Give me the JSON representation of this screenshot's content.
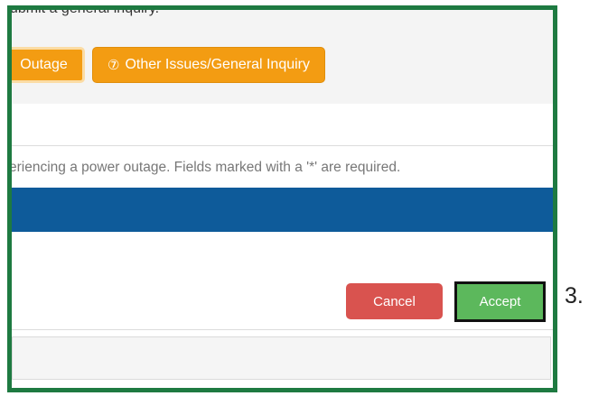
{
  "header": {
    "cut_text": "ubmit a general inquiry."
  },
  "buttons": {
    "outage_label": "Outage",
    "other_label": "Other Issues/General Inquiry",
    "other_icon": "question-circle-icon",
    "cancel_label": "Cancel",
    "accept_label": "Accept"
  },
  "form": {
    "info_text": "eriencing a power outage. Fields marked with a '*' are required."
  },
  "annotation": {
    "step_number": "3."
  },
  "colors": {
    "frame": "#1e7a41",
    "orange": "#f39c12",
    "blue": "#0e5b9a",
    "cancel": "#d9534f",
    "accept": "#5cb85c"
  }
}
